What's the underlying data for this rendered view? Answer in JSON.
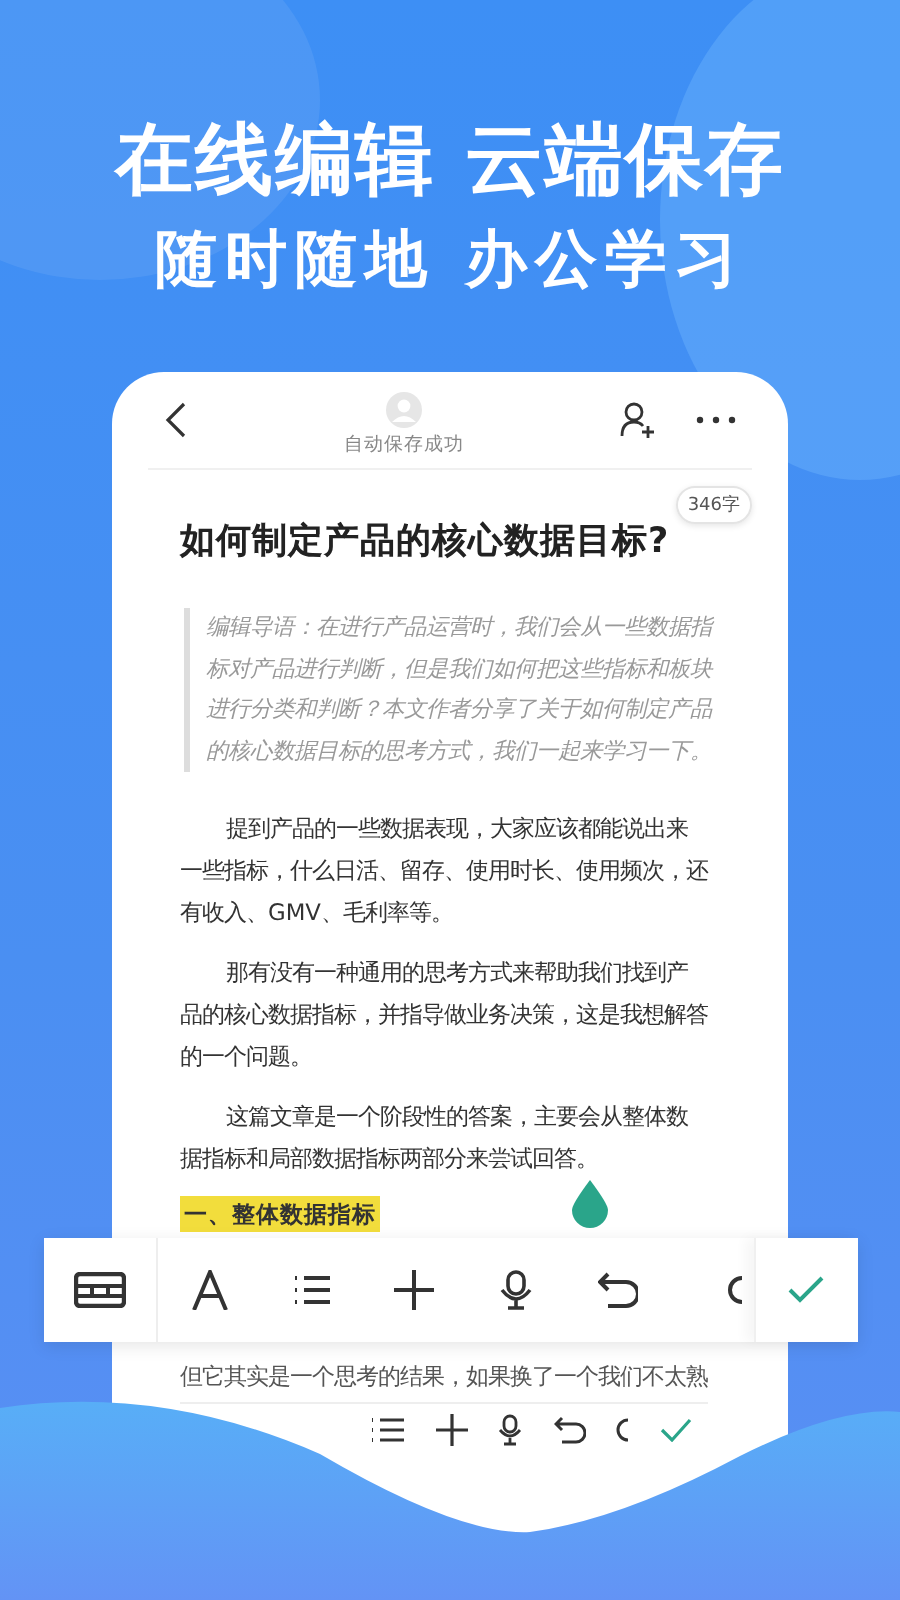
{
  "headline": "在线编辑 云端保存",
  "subheadline": "随时随地 办公学习",
  "editor": {
    "save_status": "自动保存成功",
    "word_count": "346字",
    "title": "如何制定产品的核心数据目标?",
    "lead": "编辑导语：在进行产品运营时，我们会从一些数据指标对产品进行判断，但是我们如何把这些指标和板块进行分类和判断？本文作者分享了关于如何制定产品的核心数据目标的思考方式，我们一起来学习一下。",
    "paragraphs": [
      "提到产品的一些数据表现，大家应该都能说出来一些指标，什么日活、留存、使用时长、使用频次，还有收入、GMV、毛利率等。",
      "那有没有一种通用的思考方式来帮助我们找到产品的核心数据指标，并指导做业务决策，这是我想解答的一个问题。",
      "这篇文章是一个阶段性的答案，主要会从整体数据指标和局部数据指标两部分来尝试回答。"
    ],
    "heading": "一、整体数据指标",
    "next_line": "但它其实是一个思考的结果，如果换了一个我们不太熟"
  }
}
